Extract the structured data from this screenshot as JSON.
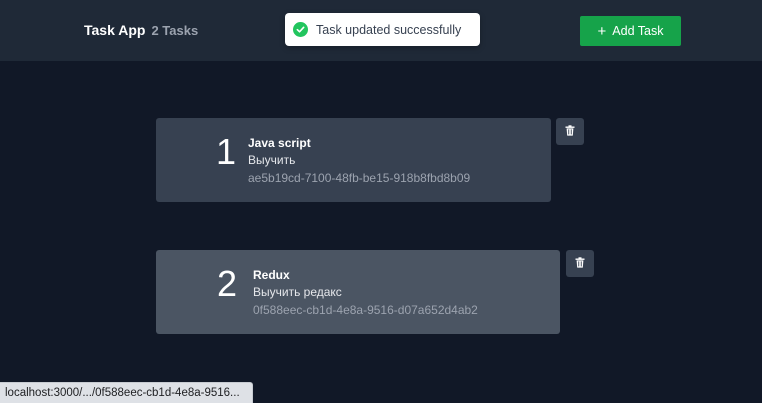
{
  "header": {
    "title": "Task App",
    "count": "2 Tasks",
    "add_button_label": "Add Task",
    "add_button_icon": "plus-icon"
  },
  "toast": {
    "message": "Task updated successfully",
    "icon": "check-circle-icon",
    "color": "#22c55e"
  },
  "tasks": [
    {
      "number": "1",
      "title": "Java script",
      "description": "Выучить",
      "id": "ae5b19cd-7100-48fb-be15-918b8fbd8b09",
      "delete_icon": "trash-icon"
    },
    {
      "number": "2",
      "title": "Redux",
      "description": "Выучить редакс",
      "id": "0f588eec-cb1d-4e8a-9516-d07a652d4ab2",
      "delete_icon": "trash-icon"
    }
  ],
  "status_bar": {
    "url": "localhost:3000/.../0f588eec-cb1d-4e8a-9516..."
  },
  "colors": {
    "background": "#111827",
    "header": "#1f2937",
    "accent": "#16a34a",
    "card": "#374151",
    "card_hover": "#4b5563"
  }
}
